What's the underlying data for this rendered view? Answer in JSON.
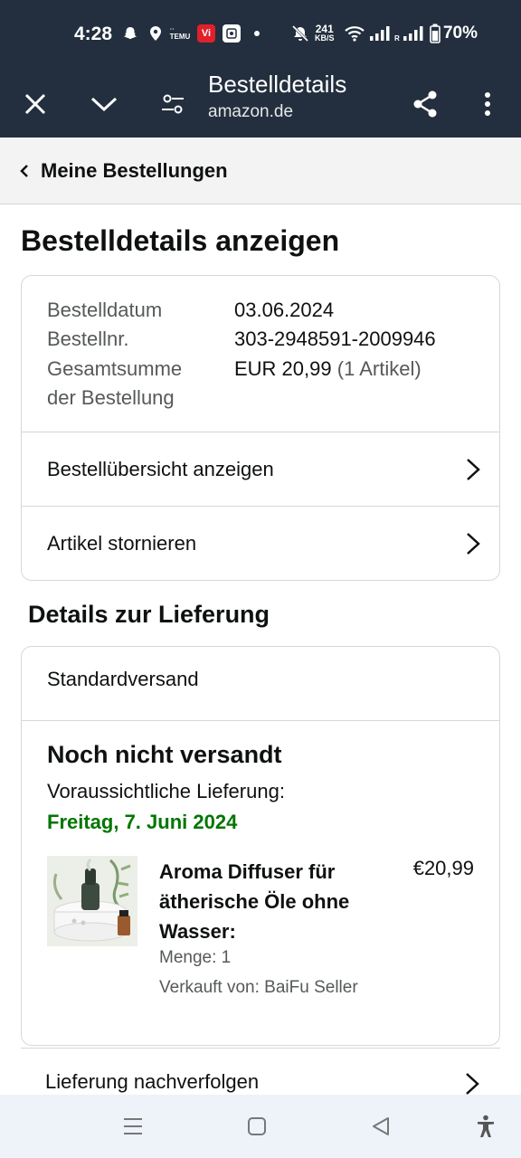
{
  "status_bar": {
    "time": "4:28",
    "net_speed_value": "241",
    "net_speed_unit": "KB/S",
    "battery": "70%",
    "icons": [
      "snapchat-icon",
      "location-icon",
      "temu-icon",
      "vi-icon",
      "app-icon",
      "dot-icon",
      "mute-icon",
      "wifi-icon",
      "signal-icon",
      "signal-roaming-icon",
      "battery-icon"
    ]
  },
  "toolbar": {
    "title": "Bestelldetails",
    "subtitle": "amazon.de"
  },
  "breadcrumb": {
    "label": "Meine Bestellungen"
  },
  "page_title": "Bestelldetails anzeigen",
  "order_summary": {
    "date_label": "Bestelldatum",
    "date_value": "03.06.2024",
    "number_label": "Bestellnr.",
    "number_value": "303-2948591-2009946",
    "total_label_line1": "Gesamtsumme",
    "total_label_line2": "der Bestellung",
    "total_value": "EUR 20,99",
    "total_items": "(1 Artikel)",
    "links": [
      {
        "label": "Bestellübersicht anzeigen"
      },
      {
        "label": "Artikel stornieren"
      }
    ]
  },
  "delivery": {
    "section_title": "Details zur Lieferung",
    "shipping_type": "Standardversand",
    "status": "Noch nicht versandt",
    "expected_label": "Voraussichtliche Lieferung:",
    "expected_date": "Freitag, 7. Juni 2024",
    "product": {
      "name": "Aroma Diffuser für ätherische Öle ohne Wasser:",
      "price": "€20,99",
      "quantity": "Menge: 1",
      "seller": "Verkauft von: BaiFu Seller"
    },
    "track_label": "Lieferung nachverfolgen"
  },
  "colors": {
    "header_bg": "#232f3e",
    "delivery_green": "#007600",
    "border": "#d5d9d9",
    "nav_bg": "#eef2f9"
  }
}
